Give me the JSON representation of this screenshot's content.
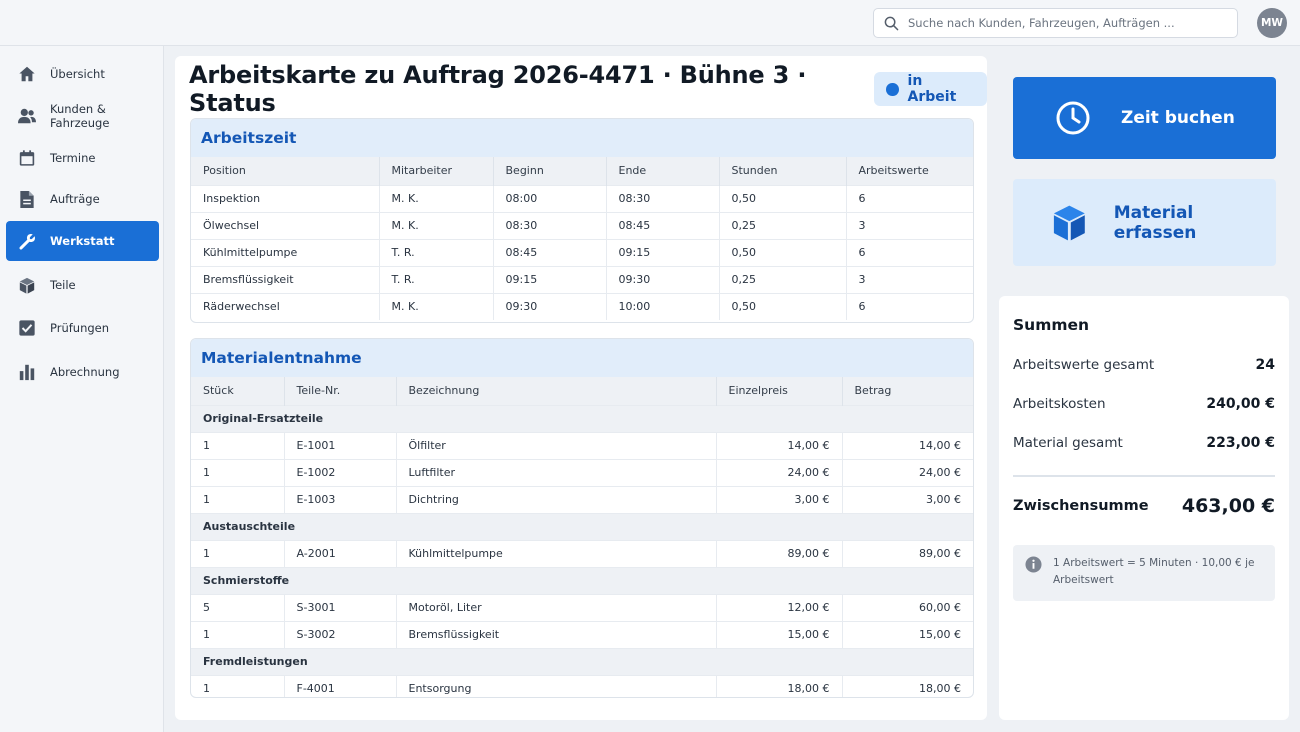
{
  "search": {
    "placeholder": "Suche nach Kunden, Fahrzeugen, Aufträgen ..."
  },
  "user": {
    "initials": "MW"
  },
  "sidebar": {
    "items": [
      {
        "label": "Übersicht",
        "icon": "home-icon"
      },
      {
        "label": "Kunden & Fahrzeuge",
        "icon": "users-icon"
      },
      {
        "label": "Termine",
        "icon": "calendar-icon"
      },
      {
        "label": "Aufträge",
        "icon": "document-icon"
      },
      {
        "label": "Werkstatt",
        "icon": "wrench-icon",
        "active": true
      },
      {
        "label": "Teile",
        "icon": "box-icon"
      },
      {
        "label": "Prüfungen",
        "icon": "checkbox-icon"
      },
      {
        "label": "Abrechnung",
        "icon": "bar-chart-icon"
      }
    ]
  },
  "main": {
    "title": "Arbeitskarte zu Auftrag 2026-4471 · Bühne 3 · Status",
    "status": "in Arbeit"
  },
  "work_time": {
    "heading": "Arbeitszeit",
    "columns": [
      "Position",
      "Mitarbeiter",
      "Beginn",
      "Ende",
      "Stunden",
      "Arbeitswerte"
    ],
    "rows": [
      [
        "Inspektion",
        "M. K.",
        "08:00",
        "08:30",
        "0,50",
        "6"
      ],
      [
        "Ölwechsel",
        "M. K.",
        "08:30",
        "08:45",
        "0,25",
        "3"
      ],
      [
        "Kühlmittelpumpe",
        "T. R.",
        "08:45",
        "09:15",
        "0,50",
        "6"
      ],
      [
        "Bremsflüssigkeit",
        "T. R.",
        "09:15",
        "09:30",
        "0,25",
        "3"
      ],
      [
        "Räderwechsel",
        "M. K.",
        "09:30",
        "10:00",
        "0,50",
        "6"
      ]
    ]
  },
  "materials": {
    "heading": "Materialentnahme",
    "columns": [
      "Stück",
      "Teile-Nr.",
      "Bezeichnung",
      "Einzelpreis",
      "Betrag"
    ],
    "groups": [
      {
        "name": "Original-Ersatzteile",
        "rows": [
          [
            "1",
            "E-1001",
            "Ölfilter",
            "14,00 €",
            "14,00 €"
          ],
          [
            "1",
            "E-1002",
            "Luftfilter",
            "24,00 €",
            "24,00 €"
          ],
          [
            "1",
            "E-1003",
            "Dichtring",
            "3,00 €",
            "3,00 €"
          ]
        ]
      },
      {
        "name": "Austauschteile",
        "rows": [
          [
            "1",
            "A-2001",
            "Kühlmittelpumpe",
            "89,00 €",
            "89,00 €"
          ]
        ]
      },
      {
        "name": "Schmierstoffe",
        "rows": [
          [
            "5",
            "S-3001",
            "Motoröl, Liter",
            "12,00 €",
            "60,00 €"
          ],
          [
            "1",
            "S-3002",
            "Bremsflüssigkeit",
            "15,00 €",
            "15,00 €"
          ]
        ]
      },
      {
        "name": "Fremdleistungen",
        "rows": [
          [
            "1",
            "F-4001",
            "Entsorgung",
            "18,00 €",
            "18,00 €"
          ]
        ]
      }
    ]
  },
  "actions": {
    "book_time": "Zeit buchen",
    "record_material": "Material erfassen"
  },
  "sums": {
    "title": "Summen",
    "rows": [
      {
        "label": "Arbeitswerte gesamt",
        "value": "24"
      },
      {
        "label": "Arbeitskosten",
        "value": "240,00 €"
      },
      {
        "label": "Material gesamt",
        "value": "223,00 €"
      }
    ],
    "subtotal_label": "Zwischensumme",
    "subtotal_value": "463,00 €",
    "note": "1 Arbeitswert = 5 Minuten · 10,00 € je Arbeitswert"
  },
  "colors": {
    "accent": "#1a6fd6",
    "accent_light": "#dcebfb",
    "background": "#eef1f5"
  }
}
